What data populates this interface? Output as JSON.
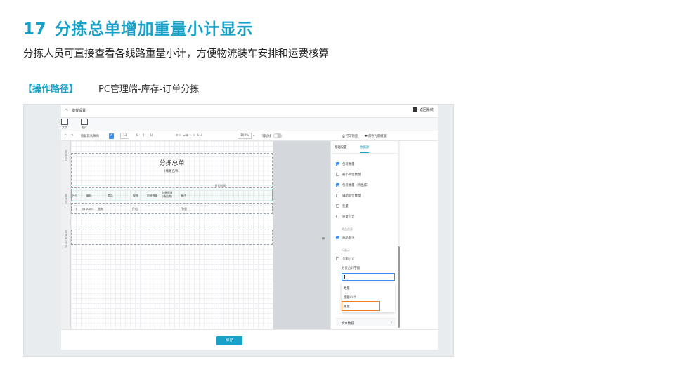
{
  "slide": {
    "number": "17",
    "title": "分拣总单增加重量小计显示",
    "subtitle": "分拣人员可直接查看各线路重量小计，方便物流装车安排和运费核算",
    "path_label": "【操作路径】",
    "path_text": "PC管理端-库存-订单分拣"
  },
  "app": {
    "back": "<",
    "title": "模板设置",
    "return_label": "返回系统",
    "icons": [
      {
        "label": "文字"
      },
      {
        "label": "图片"
      }
    ],
    "toolbar": {
      "undo": "↶",
      "redo": "↷",
      "restore": "恢复默认布局",
      "a_btn": "A",
      "font_size": "13",
      "bold": "B",
      "italic": "I",
      "underline": "U",
      "align": "≡  ⊫  ⫤  ≣  ⊨  ⊫  ≛  ⊥",
      "zoom": "100%",
      "zoom_caret": "⌄",
      "gridline": "辅助线",
      "print_preview": "打印预览",
      "save_as_new": "保存为新模板"
    },
    "ruler": {
      "header": "表头区",
      "table": "表格区",
      "footer": "表格合计区"
    },
    "doc": {
      "title": "分拣总单",
      "subtitle": "(线路名称)",
      "print_time": "打印时间:",
      "headers": [
        "序号",
        "编码",
        "商品",
        "规格",
        "包装数量",
        "包装数量(待出库)",
        "备注"
      ],
      "row": [
        "1",
        "0100001",
        "猪肉",
        "斤/包",
        "",
        "",
        "斤/袋"
      ]
    },
    "side": {
      "tabs": [
        "基础设置",
        "数据源"
      ],
      "options": [
        {
          "label": "包装数量",
          "checked": true
        },
        {
          "label": "最小单位数量",
          "checked": false
        },
        {
          "label": "包装数量（待出库）",
          "checked": true
        },
        {
          "label": "辅助单位数量",
          "checked": false
        },
        {
          "label": "重量",
          "checked": false
        },
        {
          "label": "重量小计",
          "checked": false
        }
      ],
      "sec_goods": "商品信息",
      "goods_note": {
        "label": "商品备注",
        "checked": true
      },
      "sec_total": "行合计",
      "amount_subtotal": {
        "label": "金额小计",
        "checked": false
      },
      "field_label": "分页合计字段",
      "dropdown": [
        "数量",
        "金额小计",
        "重量"
      ],
      "text_data": "文本数据",
      "text_arrow": "›",
      "drag_icon": "≡"
    },
    "save_label": "保存"
  }
}
